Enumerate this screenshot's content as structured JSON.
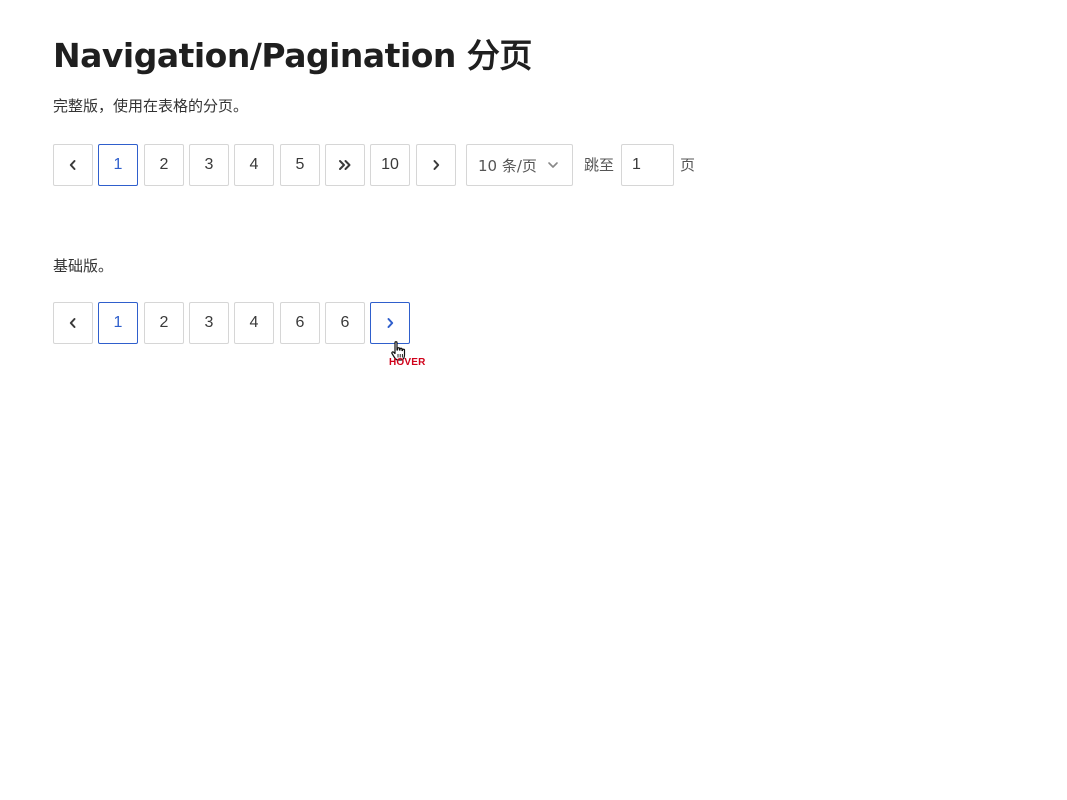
{
  "title": "Navigation/Pagination 分页",
  "full": {
    "description": "完整版，使用在表格的分页。",
    "pages": [
      "1",
      "2",
      "3",
      "4",
      "5"
    ],
    "last_page": "10",
    "active_page": "1",
    "page_size": "10 条/页",
    "jump_label": "跳至",
    "jump_value": "1",
    "jump_unit": "页",
    "icons": {
      "prev": "chevron-left-icon",
      "more": "double-chevron-right-icon",
      "next": "chevron-right-icon",
      "select": "chevron-down-icon"
    }
  },
  "basic": {
    "description": "基础版。",
    "pages": [
      "1",
      "2",
      "3",
      "4",
      "6",
      "6"
    ],
    "active_page": "1",
    "hovered": "next",
    "icons": {
      "prev": "chevron-left-icon",
      "next": "chevron-right-icon"
    }
  },
  "annotation": {
    "hover_label": "HOVER",
    "cursor": "hand-pointer-icon"
  },
  "colors": {
    "accent": "#2f5fcc",
    "border": "#d6d6d6",
    "hover_label": "#d0021b"
  }
}
